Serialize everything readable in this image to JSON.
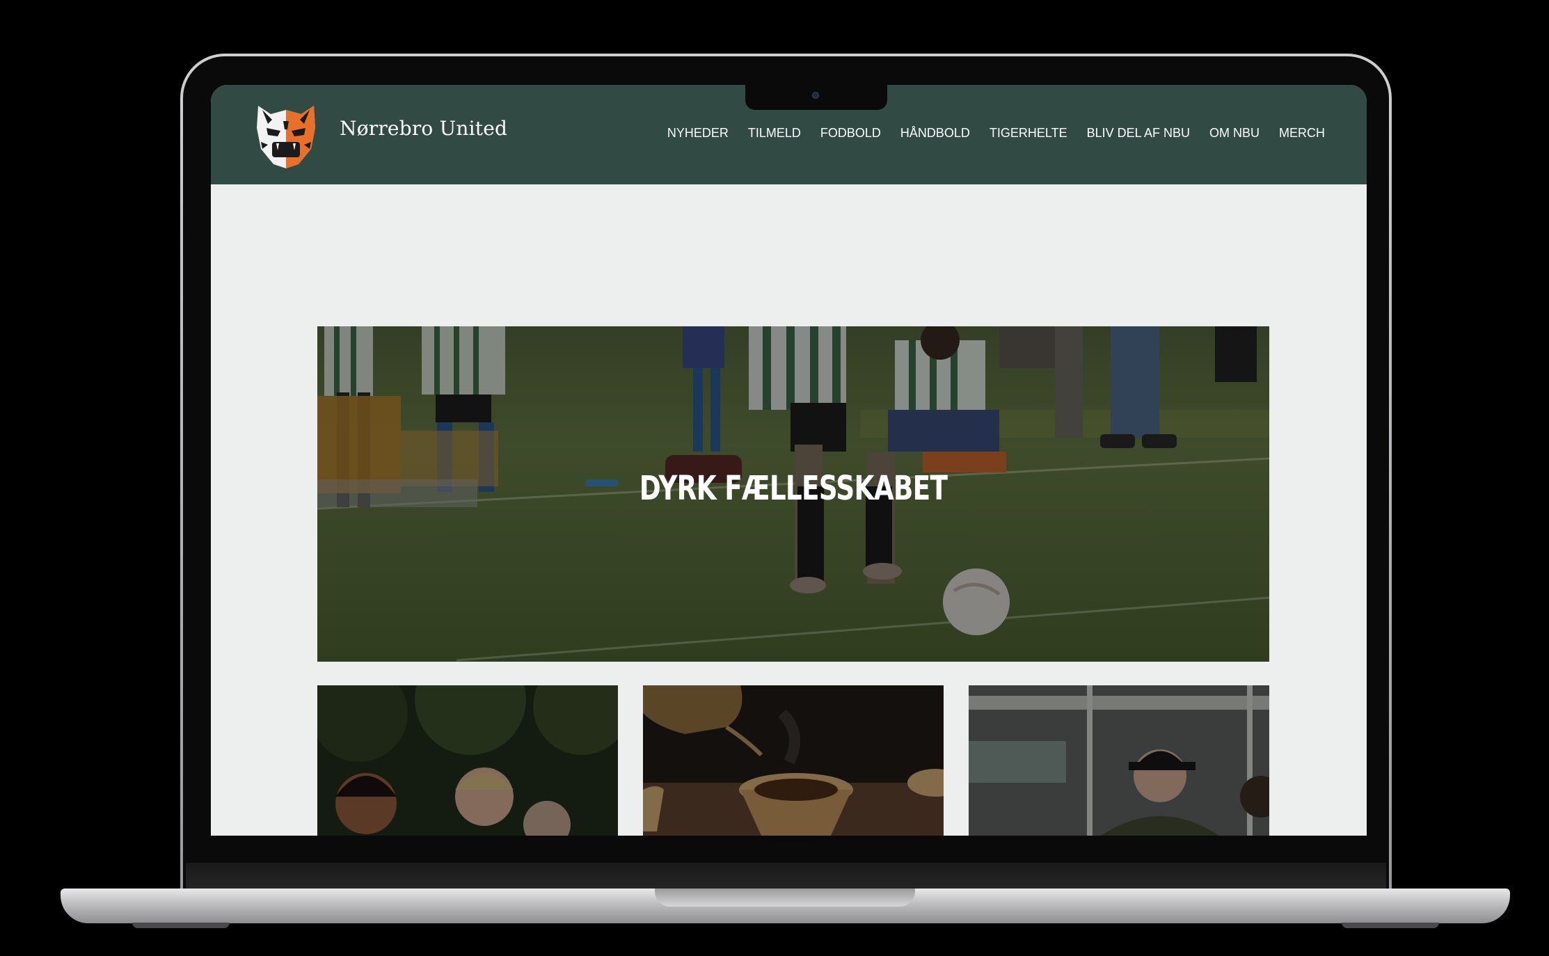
{
  "site": {
    "brand": "Nørrebro United",
    "nav": [
      "NYHEDER",
      "TILMELD",
      "FODBOLD",
      "HÅNDBOLD",
      "TIGERHELTE",
      "BLIV DEL AF NBU",
      "OM NBU",
      "MERCH"
    ]
  },
  "hero": {
    "title": "DYRK FÆLLESSKABET"
  },
  "colors": {
    "header_bg": "#324a44",
    "page_bg": "#edefee",
    "logo_orange": "#e8702a"
  },
  "icons": [
    "tiger-logo-icon"
  ]
}
